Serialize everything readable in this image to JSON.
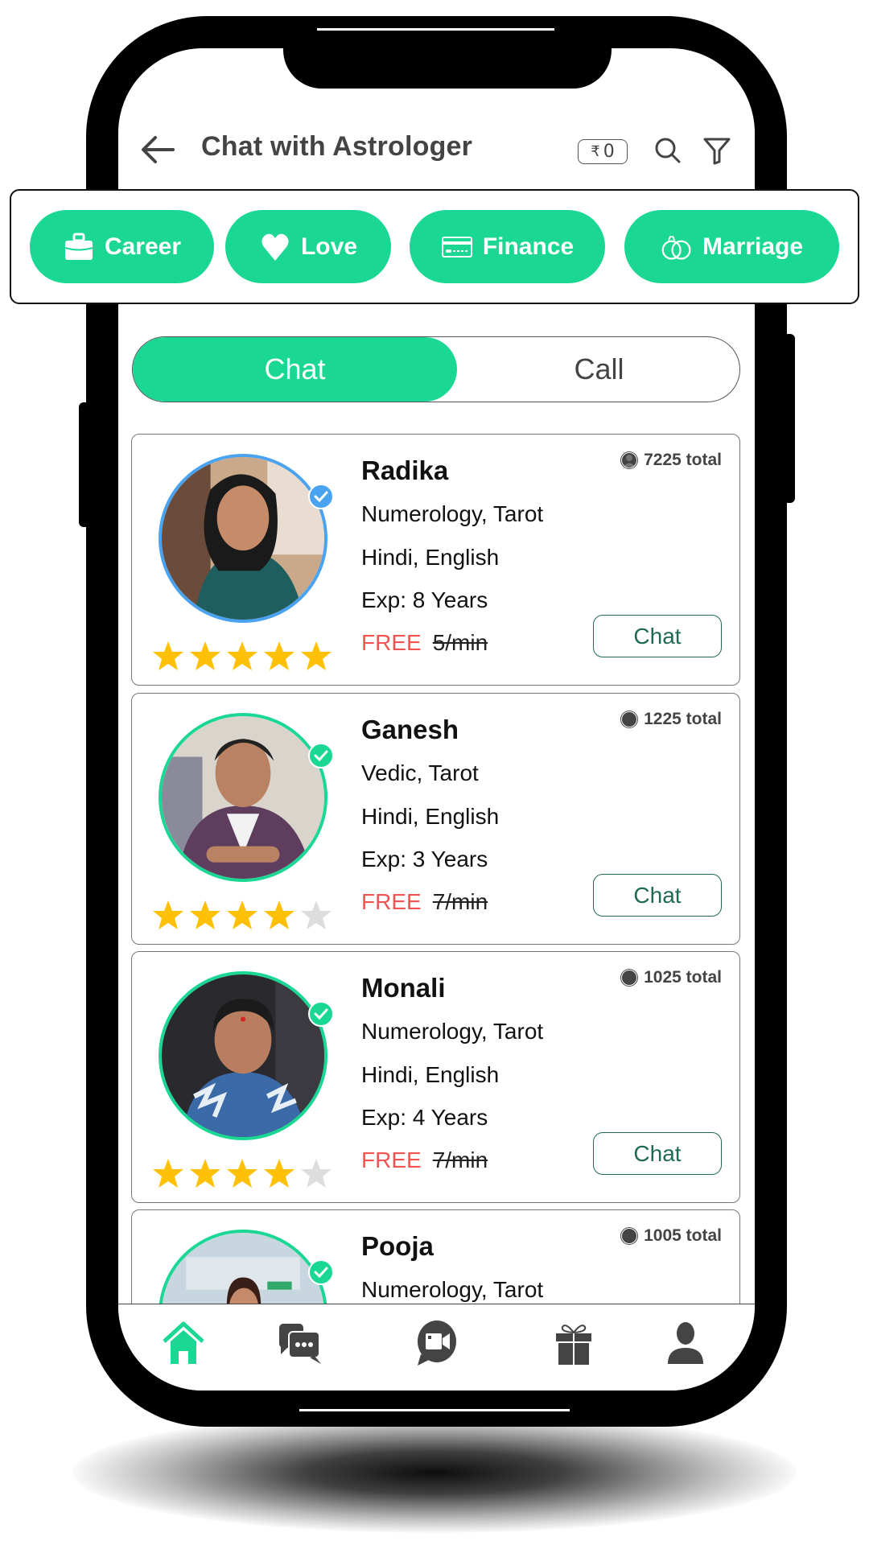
{
  "header": {
    "title": "Chat with Astrologer",
    "wallet_symbol": "₹",
    "wallet_balance": "0",
    "icons": [
      "back-arrow-icon",
      "search-icon",
      "filter-icon"
    ]
  },
  "categories": [
    {
      "label": "Career",
      "icon": "briefcase-icon"
    },
    {
      "label": "Love",
      "icon": "heart-icon"
    },
    {
      "label": "Finance",
      "icon": "credit-card-icon"
    },
    {
      "label": "Marriage",
      "icon": "rings-icon"
    }
  ],
  "toggle": {
    "options": [
      "Chat",
      "Call"
    ],
    "selected": "Chat"
  },
  "astrologers": [
    {
      "name": "Radika",
      "skills": "Numerology, Tarot",
      "languages": "Hindi, English",
      "experience": "Exp: 8 Years",
      "price_label": "FREE",
      "old_price": "5/min",
      "total": "7225 total",
      "rating": 5,
      "max_rating": 5,
      "action": "Chat",
      "verified_color": "#4aa3f0"
    },
    {
      "name": "Ganesh",
      "skills": "Vedic, Tarot",
      "languages": "Hindi, English",
      "experience": "Exp: 3 Years",
      "price_label": "FREE",
      "old_price": "7/min",
      "total": "1225 total",
      "rating": 4,
      "max_rating": 5,
      "action": "Chat",
      "verified_color": "#1ad794"
    },
    {
      "name": "Monali",
      "skills": "Numerology, Tarot",
      "languages": "Hindi, English",
      "experience": "Exp: 4 Years",
      "price_label": "FREE",
      "old_price": "7/min",
      "total": "1025 total",
      "rating": 4,
      "max_rating": 5,
      "action": "Chat",
      "verified_color": "#1ad794"
    },
    {
      "name": "Pooja",
      "skills": "Numerology, Tarot",
      "total": "1005 total",
      "verified_color": "#1ad794"
    }
  ],
  "bottom_nav": [
    {
      "name": "home",
      "icon": "home-icon",
      "active": true
    },
    {
      "name": "chats",
      "icon": "chat-bubbles-icon",
      "active": false
    },
    {
      "name": "video-call",
      "icon": "video-call-icon",
      "active": false
    },
    {
      "name": "gifts",
      "icon": "gift-icon",
      "active": false
    },
    {
      "name": "profile",
      "icon": "user-icon",
      "active": false
    }
  ],
  "colors": {
    "accent": "#1ad794",
    "free": "#f25454",
    "chat_button": "#1f6b4f",
    "star": "#ffc107",
    "star_empty": "#dddddd",
    "text_dark": "#444444"
  }
}
